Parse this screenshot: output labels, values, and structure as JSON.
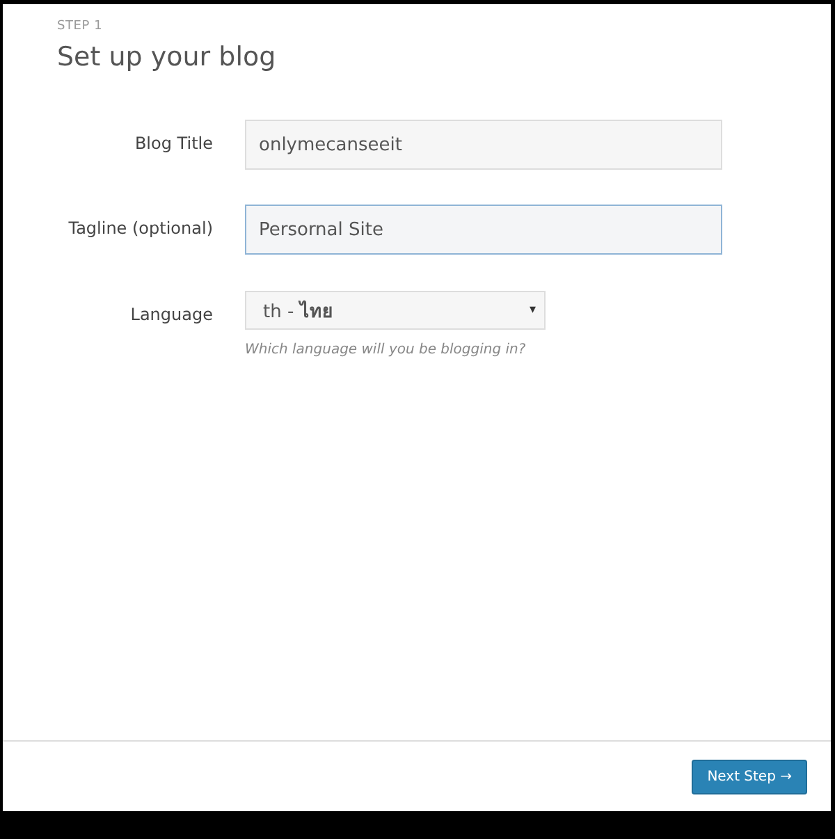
{
  "step_label": "STEP 1",
  "heading": "Set up your blog",
  "fields": [
    {
      "kind": "text",
      "label": "Blog Title",
      "value": "onlymecanseeit",
      "focused": false
    },
    {
      "kind": "text",
      "label": "Tagline (optional)",
      "value": "Persornal Site",
      "focused": true
    },
    {
      "kind": "select",
      "label": "Language",
      "value": "th - **ไทย**",
      "caret": "▾",
      "hint": "Which language will you be blogging in?"
    }
  ],
  "next_button": "Next Step →"
}
